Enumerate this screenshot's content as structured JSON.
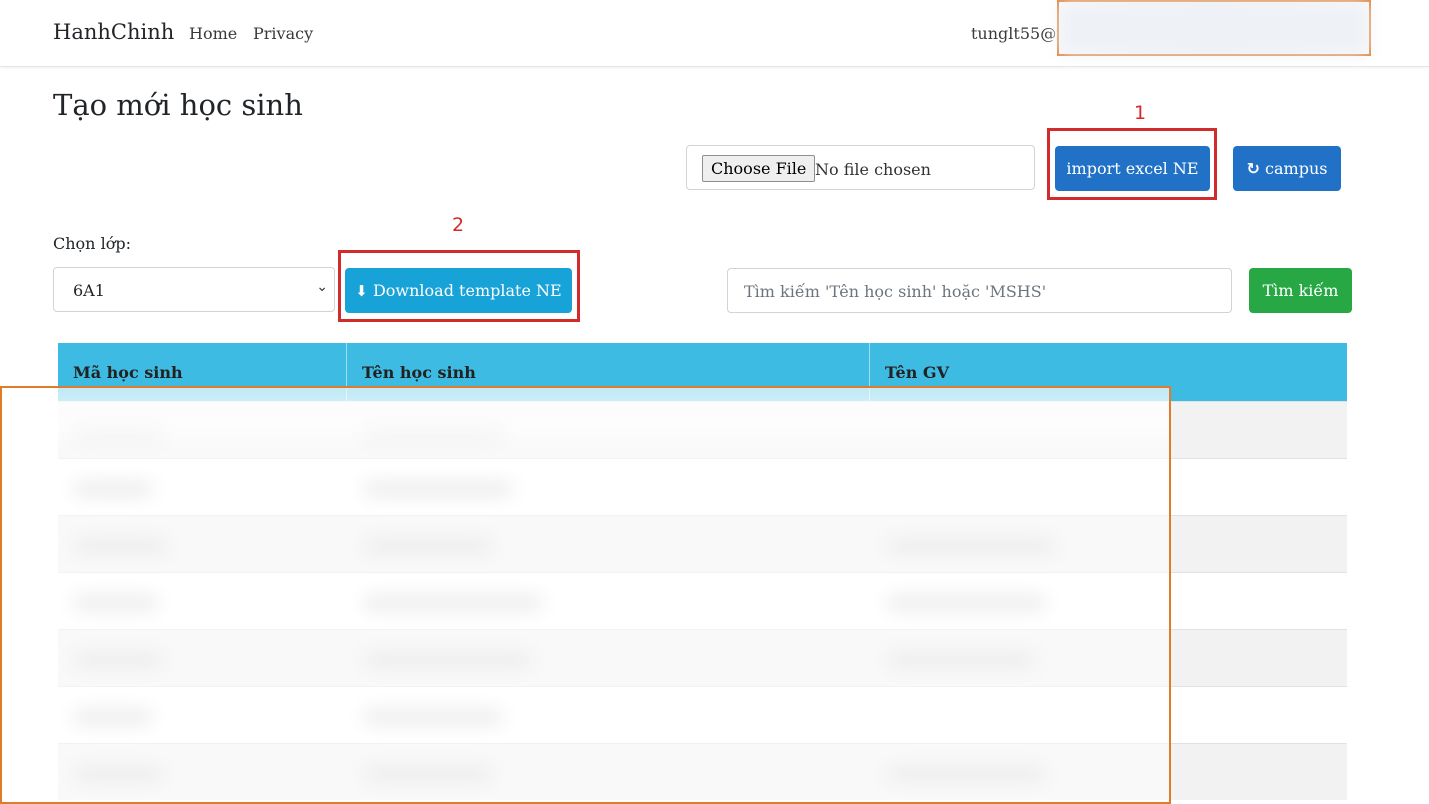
{
  "navbar": {
    "brand": "HanhChinh",
    "links": [
      "Home",
      "Privacy"
    ],
    "user_email": "tunglt55@f"
  },
  "page": {
    "title": "Tạo mới học sinh"
  },
  "annotations": [
    "1",
    "2"
  ],
  "import_section": {
    "choose_file_label": "Choose File",
    "file_status": "No file chosen",
    "import_button": "import excel NE",
    "campus_button": "campus"
  },
  "filter": {
    "class_label": "Chọn lớp:",
    "class_value": "6A1",
    "download_button": "Download template NE",
    "search_placeholder": "Tìm kiếm 'Tên học sinh' hoặc 'MSHS'",
    "search_button": "Tìm kiếm"
  },
  "table": {
    "headers": [
      "Mã học sinh",
      "Tên học sinh",
      "Tên GV"
    ]
  },
  "colors": {
    "primary": "#2172c7",
    "info": "#17a2d8",
    "success": "#28a745",
    "table_header": "#3dbbe2",
    "highlight_red": "#d12b2b",
    "redaction_orange": "#e07b2a"
  }
}
